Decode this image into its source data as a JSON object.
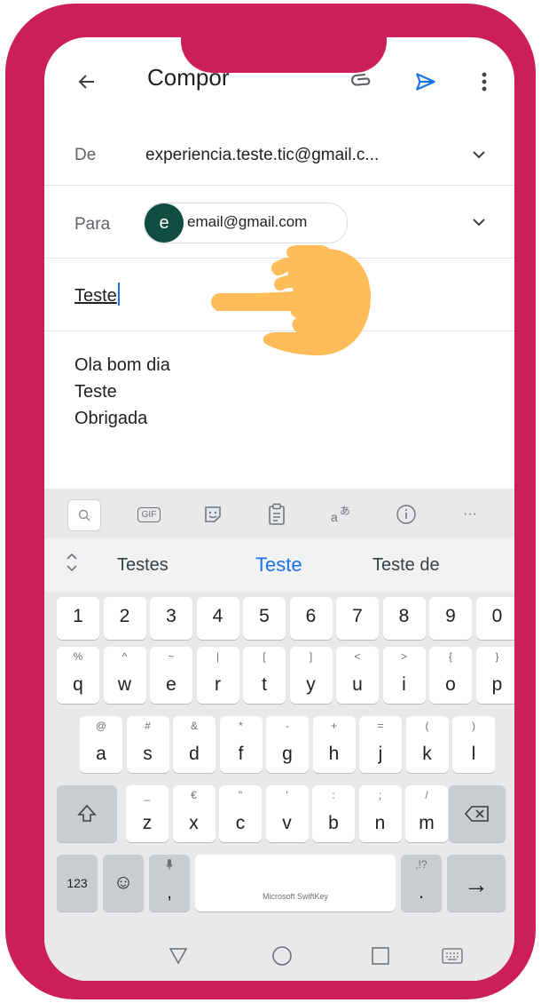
{
  "app_bar": {
    "title": "Compor",
    "back_icon": "arrow-left-icon",
    "attach_icon": "paperclip-icon",
    "send_icon": "send-icon",
    "more_icon": "more-vert-icon",
    "send_color": "#1a73e8"
  },
  "from": {
    "label": "De",
    "value": "experiencia.teste.tic@gmail.c..."
  },
  "to": {
    "label": "Para",
    "avatar_letter": "e",
    "recipient": "email@gmail.com"
  },
  "subject": {
    "value": "Teste"
  },
  "body": {
    "lines": [
      "Ola bom dia",
      "Teste",
      "Obrigada"
    ]
  },
  "keyboard": {
    "toolbar": [
      "search-icon",
      "gif-icon",
      "sticker-icon",
      "clipboard-icon",
      "translate-icon",
      "info-icon",
      "more-horiz-icon"
    ],
    "toolbar_gif": "GIF",
    "toolbar_more": "···",
    "suggestions": [
      "Testes",
      "Teste",
      "Teste de"
    ],
    "number_row": [
      "1",
      "2",
      "3",
      "4",
      "5",
      "6",
      "7",
      "8",
      "9",
      "0"
    ],
    "row1": [
      {
        "m": "q",
        "h": "%"
      },
      {
        "m": "w",
        "h": "^"
      },
      {
        "m": "e",
        "h": "~"
      },
      {
        "m": "r",
        "h": "|"
      },
      {
        "m": "t",
        "h": "["
      },
      {
        "m": "y",
        "h": "]"
      },
      {
        "m": "u",
        "h": "<"
      },
      {
        "m": "i",
        "h": ">"
      },
      {
        "m": "o",
        "h": "{"
      },
      {
        "m": "p",
        "h": "}"
      }
    ],
    "row2": [
      {
        "m": "a",
        "h": "@"
      },
      {
        "m": "s",
        "h": "#"
      },
      {
        "m": "d",
        "h": "&"
      },
      {
        "m": "f",
        "h": "*"
      },
      {
        "m": "g",
        "h": "-"
      },
      {
        "m": "h",
        "h": "+"
      },
      {
        "m": "j",
        "h": "="
      },
      {
        "m": "k",
        "h": "("
      },
      {
        "m": "l",
        "h": ")"
      }
    ],
    "row3": [
      {
        "m": "z",
        "h": "_"
      },
      {
        "m": "x",
        "h": "€"
      },
      {
        "m": "c",
        "h": "\""
      },
      {
        "m": "v",
        "h": "'"
      },
      {
        "m": "b",
        "h": ":"
      },
      {
        "m": "n",
        "h": ";"
      },
      {
        "m": "m",
        "h": "/"
      }
    ],
    "bottom": {
      "num_label": "123",
      "emoji": "☺",
      "comma": ",",
      "space_label": "Microsoft SwiftKey",
      "period": ".",
      "period_hint": ",!?",
      "mic_hint": "🎙",
      "enter": "→"
    }
  },
  "nav_bar": [
    "back-triangle-icon",
    "home-circle-icon",
    "recents-square-icon",
    "keyboard-icon"
  ],
  "colors": {
    "frame": "#cc1f5a",
    "hand": "#ffbd59",
    "avatar": "#0e4d3f",
    "accent": "#1a73e8"
  }
}
